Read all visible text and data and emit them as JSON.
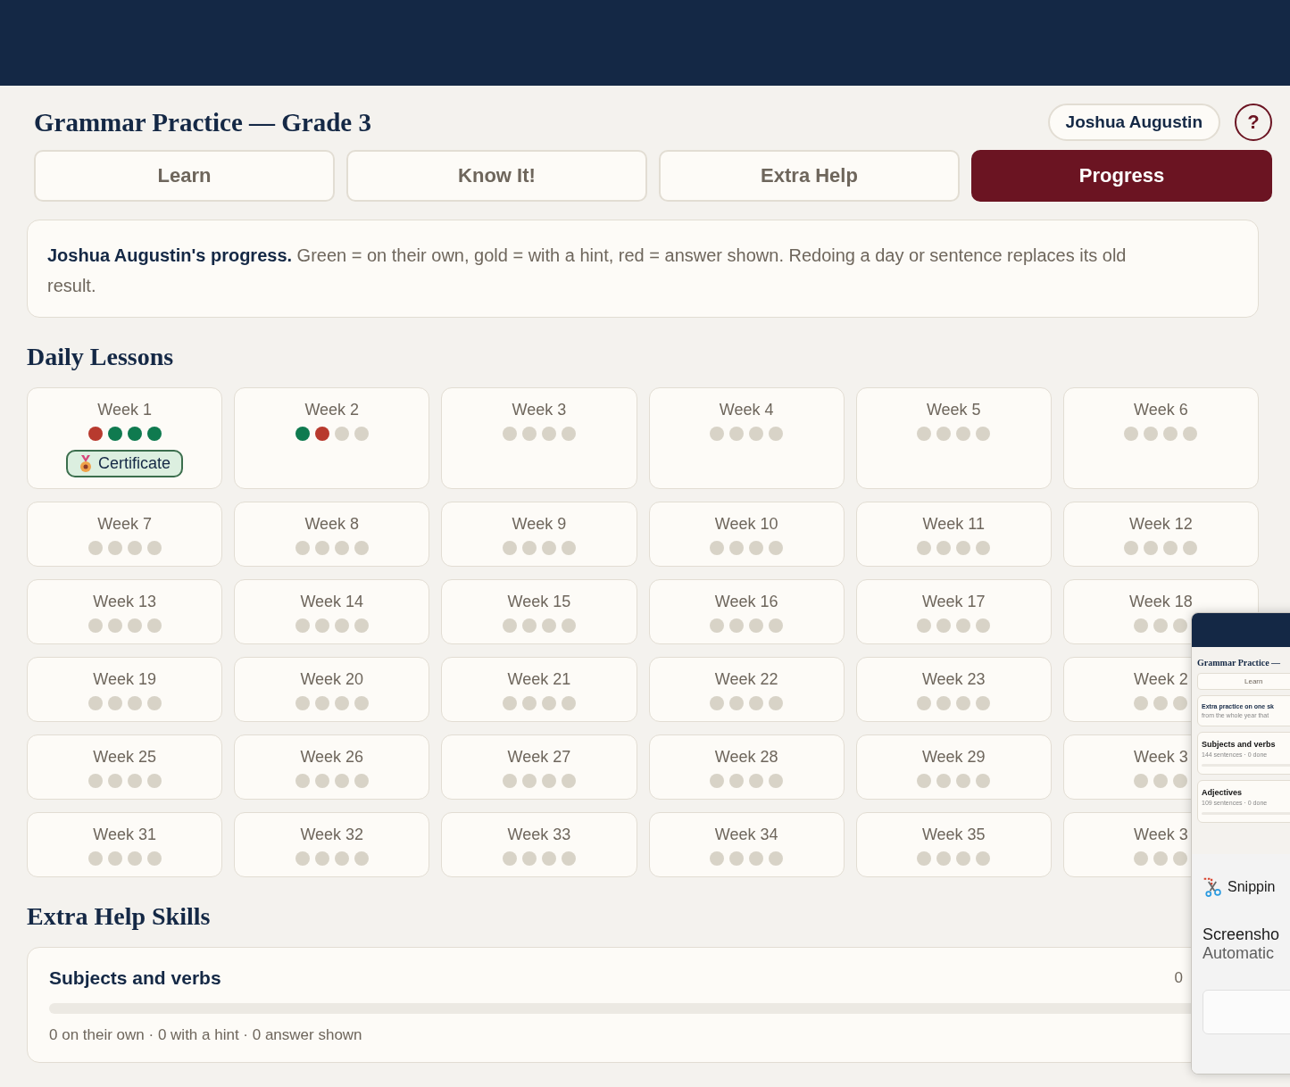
{
  "app": {
    "title": "Grammar Practice — Grade 3",
    "user": "Joshua Augustin",
    "help": "?"
  },
  "tabs": [
    {
      "label": "Learn",
      "selected": false
    },
    {
      "label": "Know It!",
      "selected": false
    },
    {
      "label": "Extra Help",
      "selected": false
    },
    {
      "label": "Progress",
      "selected": true
    }
  ],
  "intro": "**Joshua Augustin's progress.** Green = on their own, gold = with a hint, red = answer shown. Redoing a day or sentence replaces its old result.",
  "daily_lessons": {
    "heading": "Daily Lessons",
    "weeks": [
      {
        "label": "Week 1",
        "dots": [
          {
            "color": "#b83a2e"
          },
          {
            "color": "#0f7a4f"
          },
          {
            "color": "#0f7a4f"
          },
          {
            "color": "#0f7a4f"
          }
        ],
        "certificate": "Certificate"
      },
      {
        "label": "Week 2",
        "dots": [
          {
            "color": "#0f7a4f"
          },
          {
            "color": "#b83a2e"
          },
          {
            "color": "#d8d3c7"
          },
          {
            "color": "#d8d3c7"
          }
        ]
      },
      {
        "label": "Week 3",
        "dots": [
          {
            "color": "#d8d3c7"
          },
          {
            "color": "#d8d3c7"
          },
          {
            "color": "#d8d3c7"
          },
          {
            "color": "#d8d3c7"
          }
        ]
      },
      {
        "label": "Week 4",
        "dots": [
          {
            "color": "#d8d3c7"
          },
          {
            "color": "#d8d3c7"
          },
          {
            "color": "#d8d3c7"
          },
          {
            "color": "#d8d3c7"
          }
        ]
      },
      {
        "label": "Week 5",
        "dots": [
          {
            "color": "#d8d3c7"
          },
          {
            "color": "#d8d3c7"
          },
          {
            "color": "#d8d3c7"
          },
          {
            "color": "#d8d3c7"
          }
        ]
      },
      {
        "label": "Week 6",
        "dots": [
          {
            "color": "#d8d3c7"
          },
          {
            "color": "#d8d3c7"
          },
          {
            "color": "#d8d3c7"
          },
          {
            "color": "#d8d3c7"
          }
        ]
      },
      {
        "label": "Week 7",
        "dots": [
          {
            "color": "#d8d3c7"
          },
          {
            "color": "#d8d3c7"
          },
          {
            "color": "#d8d3c7"
          },
          {
            "color": "#d8d3c7"
          }
        ]
      },
      {
        "label": "Week 8",
        "dots": [
          {
            "color": "#d8d3c7"
          },
          {
            "color": "#d8d3c7"
          },
          {
            "color": "#d8d3c7"
          },
          {
            "color": "#d8d3c7"
          }
        ]
      },
      {
        "label": "Week 9",
        "dots": [
          {
            "color": "#d8d3c7"
          },
          {
            "color": "#d8d3c7"
          },
          {
            "color": "#d8d3c7"
          },
          {
            "color": "#d8d3c7"
          }
        ]
      },
      {
        "label": "Week 10",
        "dots": [
          {
            "color": "#d8d3c7"
          },
          {
            "color": "#d8d3c7"
          },
          {
            "color": "#d8d3c7"
          },
          {
            "color": "#d8d3c7"
          }
        ]
      },
      {
        "label": "Week 11",
        "dots": [
          {
            "color": "#d8d3c7"
          },
          {
            "color": "#d8d3c7"
          },
          {
            "color": "#d8d3c7"
          },
          {
            "color": "#d8d3c7"
          }
        ]
      },
      {
        "label": "Week 12",
        "dots": [
          {
            "color": "#d8d3c7"
          },
          {
            "color": "#d8d3c7"
          },
          {
            "color": "#d8d3c7"
          },
          {
            "color": "#d8d3c7"
          }
        ]
      },
      {
        "label": "Week 13",
        "dots": [
          {
            "color": "#d8d3c7"
          },
          {
            "color": "#d8d3c7"
          },
          {
            "color": "#d8d3c7"
          },
          {
            "color": "#d8d3c7"
          }
        ]
      },
      {
        "label": "Week 14",
        "dots": [
          {
            "color": "#d8d3c7"
          },
          {
            "color": "#d8d3c7"
          },
          {
            "color": "#d8d3c7"
          },
          {
            "color": "#d8d3c7"
          }
        ]
      },
      {
        "label": "Week 15",
        "dots": [
          {
            "color": "#d8d3c7"
          },
          {
            "color": "#d8d3c7"
          },
          {
            "color": "#d8d3c7"
          },
          {
            "color": "#d8d3c7"
          }
        ]
      },
      {
        "label": "Week 16",
        "dots": [
          {
            "color": "#d8d3c7"
          },
          {
            "color": "#d8d3c7"
          },
          {
            "color": "#d8d3c7"
          },
          {
            "color": "#d8d3c7"
          }
        ]
      },
      {
        "label": "Week 17",
        "dots": [
          {
            "color": "#d8d3c7"
          },
          {
            "color": "#d8d3c7"
          },
          {
            "color": "#d8d3c7"
          },
          {
            "color": "#d8d3c7"
          }
        ]
      },
      {
        "label": "Week 18",
        "dots": [
          {
            "color": "#d8d3c7"
          },
          {
            "color": "#d8d3c7"
          },
          {
            "color": "#d8d3c7"
          }
        ]
      },
      {
        "label": "Week 19",
        "dots": [
          {
            "color": "#d8d3c7"
          },
          {
            "color": "#d8d3c7"
          },
          {
            "color": "#d8d3c7"
          },
          {
            "color": "#d8d3c7"
          }
        ]
      },
      {
        "label": "Week 20",
        "dots": [
          {
            "color": "#d8d3c7"
          },
          {
            "color": "#d8d3c7"
          },
          {
            "color": "#d8d3c7"
          },
          {
            "color": "#d8d3c7"
          }
        ]
      },
      {
        "label": "Week 21",
        "dots": [
          {
            "color": "#d8d3c7"
          },
          {
            "color": "#d8d3c7"
          },
          {
            "color": "#d8d3c7"
          },
          {
            "color": "#d8d3c7"
          }
        ]
      },
      {
        "label": "Week 22",
        "dots": [
          {
            "color": "#d8d3c7"
          },
          {
            "color": "#d8d3c7"
          },
          {
            "color": "#d8d3c7"
          },
          {
            "color": "#d8d3c7"
          }
        ]
      },
      {
        "label": "Week 23",
        "dots": [
          {
            "color": "#d8d3c7"
          },
          {
            "color": "#d8d3c7"
          },
          {
            "color": "#d8d3c7"
          },
          {
            "color": "#d8d3c7"
          }
        ]
      },
      {
        "label": "Week 2",
        "dots": [
          {
            "color": "#d8d3c7"
          },
          {
            "color": "#d8d3c7"
          },
          {
            "color": "#d8d3c7"
          }
        ]
      },
      {
        "label": "Week 25",
        "dots": [
          {
            "color": "#d8d3c7"
          },
          {
            "color": "#d8d3c7"
          },
          {
            "color": "#d8d3c7"
          },
          {
            "color": "#d8d3c7"
          }
        ]
      },
      {
        "label": "Week 26",
        "dots": [
          {
            "color": "#d8d3c7"
          },
          {
            "color": "#d8d3c7"
          },
          {
            "color": "#d8d3c7"
          },
          {
            "color": "#d8d3c7"
          }
        ]
      },
      {
        "label": "Week 27",
        "dots": [
          {
            "color": "#d8d3c7"
          },
          {
            "color": "#d8d3c7"
          },
          {
            "color": "#d8d3c7"
          },
          {
            "color": "#d8d3c7"
          }
        ]
      },
      {
        "label": "Week 28",
        "dots": [
          {
            "color": "#d8d3c7"
          },
          {
            "color": "#d8d3c7"
          },
          {
            "color": "#d8d3c7"
          },
          {
            "color": "#d8d3c7"
          }
        ]
      },
      {
        "label": "Week 29",
        "dots": [
          {
            "color": "#d8d3c7"
          },
          {
            "color": "#d8d3c7"
          },
          {
            "color": "#d8d3c7"
          },
          {
            "color": "#d8d3c7"
          }
        ]
      },
      {
        "label": "Week 3",
        "dots": [
          {
            "color": "#d8d3c7"
          },
          {
            "color": "#d8d3c7"
          },
          {
            "color": "#d8d3c7"
          }
        ]
      },
      {
        "label": "Week 31",
        "dots": [
          {
            "color": "#d8d3c7"
          },
          {
            "color": "#d8d3c7"
          },
          {
            "color": "#d8d3c7"
          },
          {
            "color": "#d8d3c7"
          }
        ]
      },
      {
        "label": "Week 32",
        "dots": [
          {
            "color": "#d8d3c7"
          },
          {
            "color": "#d8d3c7"
          },
          {
            "color": "#d8d3c7"
          },
          {
            "color": "#d8d3c7"
          }
        ]
      },
      {
        "label": "Week 33",
        "dots": [
          {
            "color": "#d8d3c7"
          },
          {
            "color": "#d8d3c7"
          },
          {
            "color": "#d8d3c7"
          },
          {
            "color": "#d8d3c7"
          }
        ]
      },
      {
        "label": "Week 34",
        "dots": [
          {
            "color": "#d8d3c7"
          },
          {
            "color": "#d8d3c7"
          },
          {
            "color": "#d8d3c7"
          },
          {
            "color": "#d8d3c7"
          }
        ]
      },
      {
        "label": "Week 35",
        "dots": [
          {
            "color": "#d8d3c7"
          },
          {
            "color": "#d8d3c7"
          },
          {
            "color": "#d8d3c7"
          },
          {
            "color": "#d8d3c7"
          }
        ]
      },
      {
        "label": "Week 3",
        "dots": [
          {
            "color": "#d8d3c7"
          },
          {
            "color": "#d8d3c7"
          },
          {
            "color": "#d8d3c7"
          }
        ]
      }
    ]
  },
  "extra_help": {
    "heading": "Extra Help Skills",
    "skills": [
      {
        "name": "Subjects and verbs",
        "count": "0",
        "summary": "0 on their own · 0 with a hint · 0 answer shown"
      }
    ]
  },
  "snipping_notification": {
    "preview": {
      "title": "Grammar Practice —",
      "tab": "Learn",
      "intro": "Extra practice on one sk",
      "intro_sub": "from the whole year that",
      "skills": [
        {
          "name": "Subjects and verbs",
          "meta": "144 sentences · 0 done"
        },
        {
          "name": "Adjectives",
          "meta": "109 sentences · 0 done"
        }
      ]
    },
    "app_name": "Snippin",
    "title": "Screensho",
    "subtitle": "Automatic"
  }
}
